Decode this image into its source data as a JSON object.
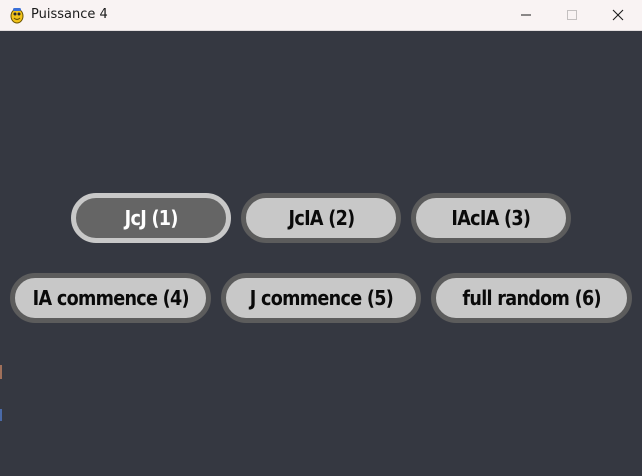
{
  "window": {
    "title": "Puissance 4",
    "app_icon": "pygame-snake-icon",
    "controls": {
      "minimize": "minimize-icon",
      "maximize": "maximize-icon",
      "close": "close-icon"
    }
  },
  "colors": {
    "background": "#353841",
    "button_fill": "#c8c8c8",
    "button_border": "#5c5c5c",
    "selected_fill": "#656565",
    "selected_border": "#c8c8c8",
    "button_text": "#0a0a0a",
    "selected_text": "#ffffff"
  },
  "menu": {
    "row1": [
      {
        "label": "JcJ (1)",
        "selected": true
      },
      {
        "label": "JcIA (2)",
        "selected": false
      },
      {
        "label": "IAcIA (3)",
        "selected": false
      }
    ],
    "row2": [
      {
        "label": "IA commence (4)",
        "selected": false
      },
      {
        "label": "J commence (5)",
        "selected": false
      },
      {
        "label": "full random (6)",
        "selected": false
      }
    ]
  }
}
